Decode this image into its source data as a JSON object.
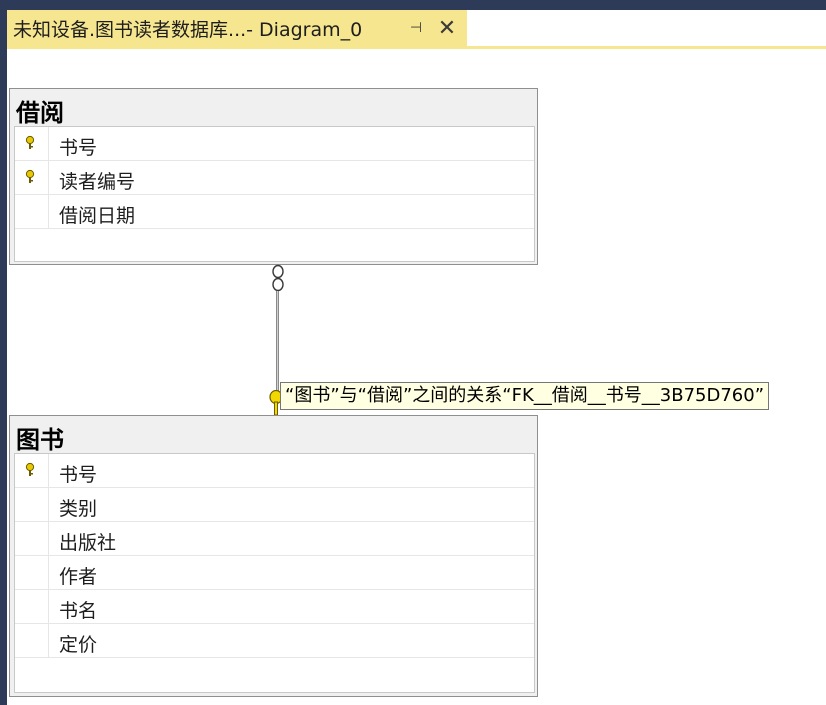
{
  "tab": {
    "title": "未知设备.图书读者数据库...- Diagram_0",
    "pin_glyph": "⊣",
    "close_glyph": "✕"
  },
  "tables": {
    "borrow": {
      "name": "借阅",
      "columns": [
        {
          "name": "书号",
          "primary_key": true
        },
        {
          "name": "读者编号",
          "primary_key": true
        },
        {
          "name": "借阅日期",
          "primary_key": false
        }
      ]
    },
    "book": {
      "name": "图书",
      "columns": [
        {
          "name": "书号",
          "primary_key": true
        },
        {
          "name": "类别",
          "primary_key": false
        },
        {
          "name": "出版社",
          "primary_key": false
        },
        {
          "name": "作者",
          "primary_key": false
        },
        {
          "name": "书名",
          "primary_key": false
        },
        {
          "name": "定价",
          "primary_key": false
        }
      ]
    }
  },
  "relationship": {
    "tooltip": "“图书”与“借阅”之间的关系“FK__借阅__书号__3B75D760”"
  },
  "colors": {
    "tab_active": "#f5e68f",
    "chrome": "#2d3b59",
    "key_icon": "#e8c800",
    "tooltip_bg": "#ffffe1"
  }
}
